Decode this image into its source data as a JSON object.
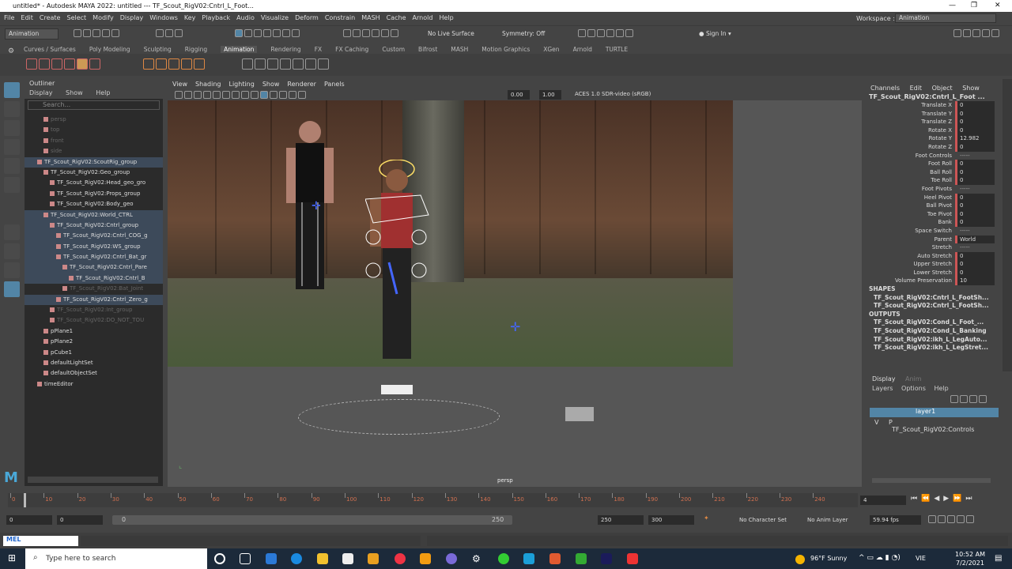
{
  "window": {
    "title": "untitled* - Autodesk MAYA 2022: untitled   ---   TF_Scout_RigV02:Cntrl_L_Foot...",
    "controls": [
      "—",
      "❐",
      "✕"
    ]
  },
  "menubar": [
    "File",
    "Edit",
    "Create",
    "Select",
    "Modify",
    "Display",
    "Windows",
    "Key",
    "Playback",
    "Audio",
    "Visualize",
    "Deform",
    "Constrain",
    "MASH",
    "Cache",
    "Arnold",
    "Help"
  ],
  "workspace": {
    "label": "Workspace :",
    "value": "Animation"
  },
  "statusline": {
    "menuset": "Animation",
    "live_surface": "No Live Surface",
    "symmetry": "Symmetry: Off",
    "signin": "Sign In"
  },
  "shelf_tabs": [
    "Curves / Surfaces",
    "Poly Modeling",
    "Sculpting",
    "Rigging",
    "Animation",
    "Rendering",
    "FX",
    "FX Caching",
    "Custom",
    "Bifrost",
    "MASH",
    "Motion Graphics",
    "XGen",
    "Arnold",
    "TURTLE"
  ],
  "shelf_active": "Animation",
  "outliner": {
    "title": "Outliner",
    "menus": [
      "Display",
      "Show",
      "Help"
    ],
    "search_placeholder": "Search...",
    "items": [
      {
        "label": "persp",
        "dim": true,
        "indent": 1
      },
      {
        "label": "top",
        "dim": true,
        "indent": 1
      },
      {
        "label": "front",
        "dim": true,
        "indent": 1
      },
      {
        "label": "side",
        "dim": true,
        "indent": 1
      },
      {
        "label": "TF_Scout_RigV02:ScoutRig_group",
        "sel": true,
        "indent": 0
      },
      {
        "label": "TF_Scout_RigV02:Geo_group",
        "indent": 1
      },
      {
        "label": "TF_Scout_RigV02:Head_geo_gro",
        "indent": 2
      },
      {
        "label": "TF_Scout_RigV02:Props_group",
        "indent": 2
      },
      {
        "label": "TF_Scout_RigV02:Body_geo",
        "indent": 2
      },
      {
        "label": "TF_Scout_RigV02:World_CTRL",
        "sel": true,
        "indent": 1
      },
      {
        "label": "TF_Scout_RigV02:Cntrl_group",
        "sel": true,
        "indent": 2
      },
      {
        "label": "TF_Scout_RigV02:Cntrl_COG_g",
        "sel": true,
        "indent": 3
      },
      {
        "label": "TF_Scout_RigV02:WS_group",
        "sel": true,
        "indent": 3
      },
      {
        "label": "TF_Scout_RigV02:Cntrl_Bat_gr",
        "sel": true,
        "indent": 3
      },
      {
        "label": "TF_Scout_RigV02:Cntrl_Pare",
        "sel": true,
        "indent": 4
      },
      {
        "label": "TF_Scout_RigV02:Cntrl_B",
        "sel": true,
        "indent": 5
      },
      {
        "label": "TF_Scout_RigV02:Bat_Joint",
        "dim": true,
        "indent": 4
      },
      {
        "label": "TF_Scout_RigV02:Cntrl_Zero_g",
        "sel": true,
        "indent": 3
      },
      {
        "label": "TF_Scout_RigV02:Int_group",
        "dim": true,
        "indent": 2
      },
      {
        "label": "TF_Scout_RigV02:DO_NOT_TOU",
        "dim": true,
        "indent": 2
      },
      {
        "label": "pPlane1",
        "indent": 1
      },
      {
        "label": "pPlane2",
        "indent": 1
      },
      {
        "label": "pCube1",
        "indent": 1
      },
      {
        "label": "defaultLightSet",
        "indent": 1
      },
      {
        "label": "defaultObjectSet",
        "indent": 1
      },
      {
        "label": "timeEditor",
        "indent": 0
      }
    ]
  },
  "viewport": {
    "menus": [
      "View",
      "Shading",
      "Lighting",
      "Show",
      "Renderer",
      "Panels"
    ],
    "field1": "0.00",
    "field2": "1.00",
    "colorspace": "ACES 1.0 SDR-video (sRGB)",
    "camera": "persp"
  },
  "channelbox": {
    "menus": [
      "Channels",
      "Edit",
      "Object",
      "Show"
    ],
    "node": "TF_Scout_RigV02:Cntrl_L_Foot ...",
    "attrs": [
      {
        "n": "Translate X",
        "v": "0"
      },
      {
        "n": "Translate Y",
        "v": "0"
      },
      {
        "n": "Translate Z",
        "v": "0"
      },
      {
        "n": "Rotate X",
        "v": "0"
      },
      {
        "n": "Rotate Y",
        "v": "12.982"
      },
      {
        "n": "Rotate Z",
        "v": "0"
      },
      {
        "n": "Foot Controls",
        "v": "-----",
        "hdr": true
      },
      {
        "n": "Foot Roll",
        "v": "0"
      },
      {
        "n": "Ball Roll",
        "v": "0"
      },
      {
        "n": "Toe Roll",
        "v": "0"
      },
      {
        "n": "Foot Pivots",
        "v": "-----",
        "hdr": true
      },
      {
        "n": "Heel Pivot",
        "v": "0"
      },
      {
        "n": "Ball Pivot",
        "v": "0"
      },
      {
        "n": "Toe Pivot",
        "v": "0"
      },
      {
        "n": "Bank",
        "v": "0"
      },
      {
        "n": "Space Switch",
        "v": "-----",
        "hdr": true
      },
      {
        "n": "Parent",
        "v": "World"
      },
      {
        "n": "Stretch",
        "v": "-----",
        "hdr": true
      },
      {
        "n": "Auto Stretch",
        "v": "0"
      },
      {
        "n": "Upper Stretch",
        "v": "0"
      },
      {
        "n": "Lower Stretch",
        "v": "0"
      },
      {
        "n": "Volume Preservation",
        "v": "10"
      }
    ],
    "shapes_label": "SHAPES",
    "shapes": [
      "TF_Scout_RigV02:Cntrl_L_FootSh...",
      "TF_Scout_RigV02:Cntrl_L_FootSh..."
    ],
    "outputs_label": "OUTPUTS",
    "outputs": [
      "TF_Scout_RigV02:Cond_L_Foot_...",
      "TF_Scout_RigV02:Cond_L_Banking",
      "TF_Scout_RigV02:ikh_L_LegAuto...",
      "TF_Scout_RigV02:ikh_L_LegStret..."
    ]
  },
  "layers": {
    "tabs": [
      "Display",
      "Anim"
    ],
    "menus": [
      "Layers",
      "Options",
      "Help"
    ],
    "layer1": "layer1",
    "layer2": "TF_Scout_RigV02:Controls",
    "vis": "V",
    "playback": "P"
  },
  "timeline": {
    "ticks": [
      "0",
      "10",
      "20",
      "30",
      "40",
      "50",
      "60",
      "70",
      "80",
      "90",
      "100",
      "110",
      "120",
      "130",
      "140",
      "150",
      "160",
      "170",
      "180",
      "190",
      "200",
      "210",
      "220",
      "230",
      "240"
    ],
    "current_frame": "4",
    "range_start": "0",
    "range_start2": "0",
    "range_inner_start": "0",
    "range_inner_end": "250",
    "range_end": "250",
    "range_end2": "300",
    "character_set": "No Character Set",
    "anim_layer": "No Anim Layer",
    "fps": "59.94 fps"
  },
  "cmdline": {
    "lang": "MEL"
  },
  "taskbar": {
    "search_placeholder": "Type here to search",
    "weather": "96°F  Sunny",
    "lang": "VIE",
    "time": "10:52 AM",
    "date": "7/2/2021"
  }
}
